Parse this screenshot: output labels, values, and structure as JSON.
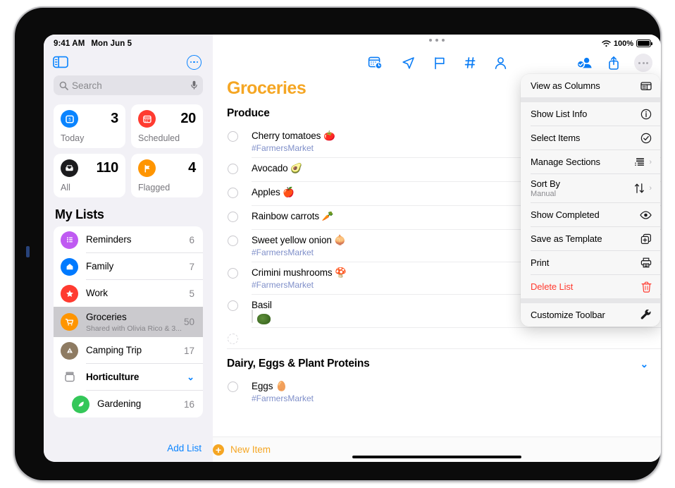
{
  "status_bar": {
    "time": "9:41 AM",
    "date": "Mon Jun 5",
    "battery_percent": "100%",
    "wifi_icon": "wifi-icon",
    "battery_icon": "battery-full-icon"
  },
  "sidebar": {
    "toggle_icon": "sidebar-toggle-icon",
    "more_icon": "more-circle-icon",
    "search": {
      "placeholder": "Search",
      "icon": "search-icon",
      "mic_icon": "microphone-icon"
    },
    "smart_lists": [
      {
        "label": "Today",
        "count": "3",
        "icon": "calendar-day-icon",
        "color": "#0a84ff"
      },
      {
        "label": "Scheduled",
        "count": "20",
        "icon": "calendar-icon",
        "color": "#ff3b30"
      },
      {
        "label": "All",
        "count": "110",
        "icon": "tray-icon",
        "color": "#1c1c1e"
      },
      {
        "label": "Flagged",
        "count": "4",
        "icon": "flag-icon",
        "color": "#ff9500"
      }
    ],
    "my_lists_title": "My Lists",
    "lists": [
      {
        "name": "Reminders",
        "count": "6",
        "icon": "bullet-list-icon",
        "color": "#bf5af2",
        "subtitle": "",
        "selected": false,
        "group": false,
        "indent": false
      },
      {
        "name": "Family",
        "count": "7",
        "icon": "house-icon",
        "color": "#007aff",
        "subtitle": "",
        "selected": false,
        "group": false,
        "indent": false
      },
      {
        "name": "Work",
        "count": "5",
        "icon": "star-icon",
        "color": "#ff3b30",
        "subtitle": "",
        "selected": false,
        "group": false,
        "indent": false
      },
      {
        "name": "Groceries",
        "count": "50",
        "icon": "cart-icon",
        "color": "#ff9500",
        "subtitle": "Shared with Olivia Rico & 3...",
        "selected": true,
        "group": false,
        "indent": false
      },
      {
        "name": "Camping Trip",
        "count": "17",
        "icon": "triangle-exclamation-icon",
        "color": "#8e7b62",
        "subtitle": "",
        "selected": false,
        "group": false,
        "indent": false
      },
      {
        "name": "Horticulture",
        "count": "",
        "icon": "folder-group-icon",
        "color": "#8e8e93",
        "subtitle": "",
        "selected": false,
        "group": true,
        "indent": false
      },
      {
        "name": "Gardening",
        "count": "16",
        "icon": "leaf-icon",
        "color": "#34c759",
        "subtitle": "",
        "selected": false,
        "group": false,
        "indent": true
      }
    ],
    "add_list_label": "Add List"
  },
  "toolbar": {
    "center_icons": [
      {
        "name": "add-date-icon",
        "label": "Add Date"
      },
      {
        "name": "location-icon",
        "label": "Add Location"
      },
      {
        "name": "flag-outline-icon",
        "label": "Flag"
      },
      {
        "name": "hashtag-icon",
        "label": "Add Tag"
      },
      {
        "name": "person-icon",
        "label": "Assign"
      }
    ],
    "right_icons": [
      {
        "name": "add-person-icon",
        "label": "Share"
      },
      {
        "name": "share-icon",
        "label": "Share Sheet"
      },
      {
        "name": "more-icon",
        "label": "More"
      }
    ],
    "drag_handle_icon": "drag-handle-dots"
  },
  "main": {
    "title": "Groceries",
    "sections": [
      {
        "name": "Produce",
        "collapsible": false,
        "items": [
          {
            "title": "Cherry tomatoes 🍅",
            "tag": "#FarmersMarket",
            "thumbnail": false
          },
          {
            "title": "Avocado 🥑",
            "tag": "",
            "thumbnail": false
          },
          {
            "title": "Apples 🍎",
            "tag": "",
            "thumbnail": false
          },
          {
            "title": "Rainbow carrots 🥕",
            "tag": "",
            "thumbnail": false
          },
          {
            "title": "Sweet yellow onion 🧅",
            "tag": "#FarmersMarket",
            "thumbnail": false
          },
          {
            "title": "Crimini mushrooms 🍄",
            "tag": "#FarmersMarket",
            "thumbnail": false
          },
          {
            "title": "Basil",
            "tag": "",
            "thumbnail": true
          },
          {
            "title": "",
            "tag": "",
            "thumbnail": false
          }
        ]
      },
      {
        "name": "Dairy, Eggs & Plant Proteins",
        "collapsible": true,
        "items": [
          {
            "title": "Eggs 🥚",
            "tag": "#FarmersMarket",
            "thumbnail": false
          }
        ]
      }
    ],
    "new_item_label": "New Item",
    "new_item_icon": "plus-circle-icon"
  },
  "context_menu": {
    "groups": [
      {
        "items": [
          {
            "label": "View as Columns",
            "sublabel": "",
            "icon": "columns-icon",
            "chevron": false,
            "danger": false
          }
        ]
      },
      {
        "items": [
          {
            "label": "Show List Info",
            "sublabel": "",
            "icon": "info-circle-icon",
            "chevron": false,
            "danger": false
          },
          {
            "label": "Select Items",
            "sublabel": "",
            "icon": "checkmark-circle-icon",
            "chevron": false,
            "danger": false
          },
          {
            "label": "Manage Sections",
            "sublabel": "",
            "icon": "manage-sections-icon",
            "chevron": true,
            "danger": false
          },
          {
            "label": "Sort By",
            "sublabel": "Manual",
            "icon": "sort-arrows-icon",
            "chevron": true,
            "danger": false
          },
          {
            "label": "Show Completed",
            "sublabel": "",
            "icon": "eye-icon",
            "chevron": false,
            "danger": false
          },
          {
            "label": "Save as Template",
            "sublabel": "",
            "icon": "duplicate-plus-icon",
            "chevron": false,
            "danger": false
          },
          {
            "label": "Print",
            "sublabel": "",
            "icon": "printer-icon",
            "chevron": false,
            "danger": false
          },
          {
            "label": "Delete List",
            "sublabel": "",
            "icon": "trash-icon",
            "chevron": false,
            "danger": true
          }
        ]
      },
      {
        "items": [
          {
            "label": "Customize Toolbar",
            "sublabel": "",
            "icon": "wrench-icon",
            "chevron": false,
            "danger": false
          }
        ]
      }
    ]
  },
  "colors": {
    "accent_blue": "#0a84ff",
    "accent_orange": "#f5a623",
    "danger_red": "#ff3b30",
    "tag_blue": "#7f8fc9"
  }
}
